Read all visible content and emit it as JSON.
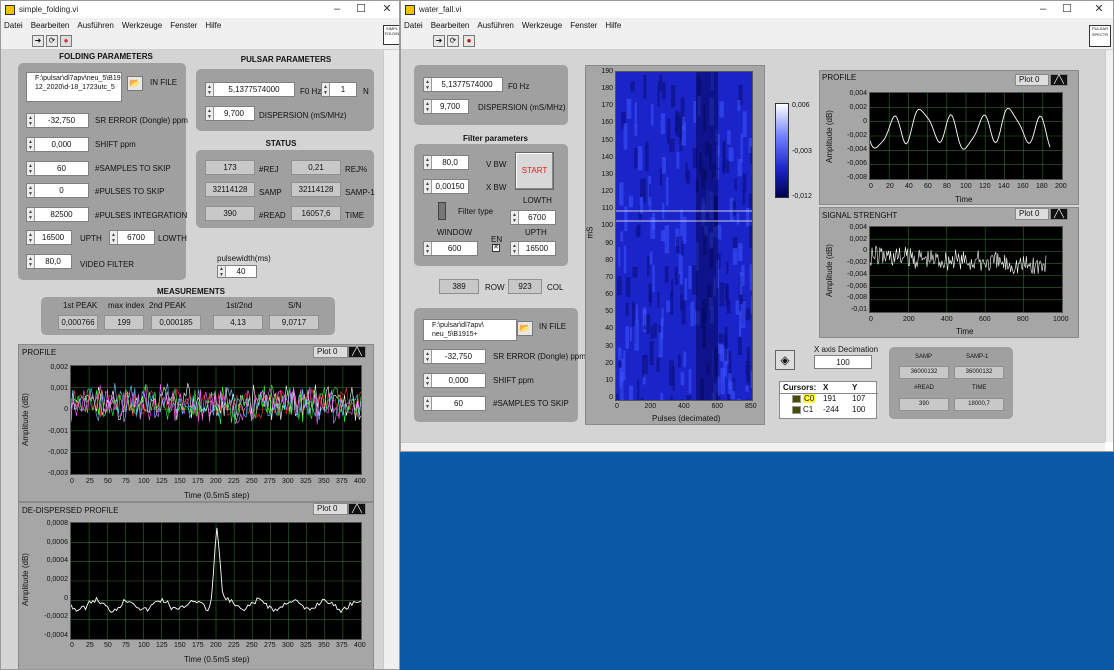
{
  "sf": {
    "title": "simple_folding.vi",
    "menu": [
      "Datei",
      "Bearbeiten",
      "Ausführen",
      "Werkzeuge",
      "Fenster",
      "Hilfe"
    ],
    "side_icon": [
      "SIMPL",
      "FOLDIN"
    ],
    "folding": {
      "header": "FOLDING PARAMETERS",
      "infile_path": "F:\\pulsar\\dl7apv\\neu_5\\B1915+\n12_2020\\d-18_1723utc_5",
      "infile_label": "IN FILE",
      "sr_error": "-32,750",
      "sr_error_label": "SR ERROR (Dongle) ppm",
      "shift": "0,000",
      "shift_label": "SHIFT ppm",
      "samples_skip": "60",
      "samples_skip_label": "#SAMPLES TO SKIP",
      "pulses_skip": "0",
      "pulses_skip_label": "#PULSES TO SKIP",
      "pulses_int": "82500",
      "pulses_int_label": "#PULSES INTEGRATION",
      "upth": "16500",
      "upth_label": "UPTH",
      "lowth": "6700",
      "lowth_label": "LOWTH",
      "video": "80,0",
      "video_label": "VIDEO FILTER"
    },
    "pulsar": {
      "header": "PULSAR PARAMETERS",
      "f0": "5,1377574000",
      "f0_label": "F0 Hz",
      "n": "1",
      "n_label": "N",
      "dispersion": "9,700",
      "dispersion_label": "DISPERSION (mS/MHz)"
    },
    "status": {
      "header": "STATUS",
      "rej": "173",
      "rej_label": "#REJ",
      "rejpct": "0,21",
      "rejpct_label": "REJ%",
      "samp": "32114128",
      "samp_label": "SAMP",
      "samp1": "32114128",
      "samp1_label": "SAMP-1",
      "read": "390",
      "read_label": "#READ",
      "time": "16057,6",
      "time_label": "TIME"
    },
    "pulsewidth_label": "pulsewidth(ms)",
    "pulsewidth": "40",
    "meas": {
      "header": "MEASUREMENTS",
      "labels": [
        "1st PEAK",
        "max index",
        "2nd PEAK",
        "1st/2nd",
        "S/N"
      ],
      "values": [
        "0,000766",
        "199",
        "0,000185",
        "4,13",
        "9,0717"
      ]
    },
    "profile": {
      "title": "PROFILE",
      "legend": "Plot 0",
      "yticks": [
        "0,002",
        "0,001",
        "0",
        "-0,001",
        "-0,002",
        "-0,003"
      ],
      "xticks": [
        "0",
        "25",
        "50",
        "75",
        "100",
        "125",
        "150",
        "175",
        "200",
        "225",
        "250",
        "275",
        "300",
        "325",
        "350",
        "375",
        "400"
      ],
      "xlabel": "Time (0.5mS step)",
      "ylabel": "Amplitude (dB)"
    },
    "dedisp": {
      "title": "DE-DISPERSED PROFILE",
      "legend": "Plot 0",
      "yticks": [
        "0,0008",
        "0,0006",
        "0,0004",
        "0,0002",
        "0",
        "-0,0002",
        "-0,0004"
      ],
      "xticks": [
        "0",
        "25",
        "50",
        "75",
        "100",
        "125",
        "150",
        "175",
        "200",
        "225",
        "250",
        "275",
        "300",
        "325",
        "350",
        "375",
        "400"
      ],
      "xlabel": "Time (0.5mS step)",
      "ylabel": "Amplitude (dB)"
    }
  },
  "wf": {
    "title": "water_fall.vi",
    "menu": [
      "Datei",
      "Bearbeiten",
      "Ausführen",
      "Werkzeuge",
      "Fenster",
      "Hilfe"
    ],
    "side_icon": [
      "PULSAR",
      "SPECTR"
    ],
    "f0": "5,1377574000",
    "f0_label": "F0 Hz",
    "dispersion": "9,700",
    "dispersion_label": "DISPERSION (mS/MHz)",
    "filter": {
      "header": "Filter parameters",
      "vbw": "80,0",
      "vbw_label": "V BW",
      "xbw": "0,00150",
      "xbw_label": "X BW",
      "start_label": "START",
      "type_label": "Filter type",
      "lowth_label": "LOWTH",
      "lowth": "6700",
      "window_label": "WINDOW",
      "window": "600",
      "en_label": "EN",
      "upth_label": "UPTH",
      "upth": "16500"
    },
    "row": "389",
    "row_label": "ROW",
    "col": "923",
    "col_label": "COL",
    "infile_path": "F:\\pulsar\\dl7apv\\\nneu_5\\B1915+",
    "infile_label": "IN FILE",
    "sr_error": "-32,750",
    "sr_error_label": "SR ERROR (Dongle) ppm",
    "shift": "0,000",
    "shift_label": "SHIFT ppm",
    "samples_skip": "60",
    "samples_skip_label": "#SAMPLES TO SKIP",
    "waterfall": {
      "yticks": [
        "190",
        "180",
        "170",
        "160",
        "150",
        "140",
        "130",
        "120",
        "110",
        "100",
        "90",
        "80",
        "70",
        "60",
        "50",
        "40",
        "30",
        "20",
        "10",
        "0"
      ],
      "xticks": [
        "0",
        "200",
        "400",
        "600",
        "850"
      ],
      "xlabel": "Pulses (decimated)",
      "ylabel": "mS",
      "colorbar": [
        "0,006",
        "-0,003",
        "-0,012"
      ]
    },
    "profile": {
      "title": "PROFILE",
      "legend": "Plot 0",
      "yticks": [
        "0,004",
        "0,002",
        "0",
        "-0,002",
        "-0,004",
        "-0,006",
        "-0,008"
      ],
      "xticks": [
        "0",
        "20",
        "40",
        "60",
        "80",
        "100",
        "120",
        "140",
        "160",
        "180",
        "200"
      ],
      "xlabel": "Time",
      "ylabel": "Amplitude (dB)"
    },
    "signal": {
      "title": "SIGNAL STRENGHT",
      "legend": "Plot 0",
      "yticks": [
        "0,004",
        "0,002",
        "0",
        "-0,002",
        "-0,004",
        "-0,006",
        "-0,008",
        "-0,01"
      ],
      "xticks": [
        "0",
        "200",
        "400",
        "600",
        "800",
        "1000"
      ],
      "xlabel": "Time",
      "ylabel": "Amplitude (dB)"
    },
    "xdec_label": "X axis Decimation",
    "xdec": "100",
    "cursors": {
      "headers": [
        "Cursors:",
        "X",
        "Y"
      ],
      "rows": [
        {
          "name": "C0",
          "x": "191",
          "y": "107"
        },
        {
          "name": "C1",
          "x": "-244",
          "y": "100"
        }
      ]
    },
    "stat": {
      "samp_label": "SAMP",
      "samp": "36000132",
      "samp1_label": "SAMP-1",
      "samp1": "36000132",
      "read_label": "#READ",
      "read": "390",
      "time_label": "TIME",
      "time": "18000,7"
    }
  },
  "colors": {
    "accent": "#0b5aa8",
    "panel": "#d4d4d4",
    "group": "#a0a0a0",
    "plot_bg": "#000000",
    "grid": "#2e6b2e"
  }
}
